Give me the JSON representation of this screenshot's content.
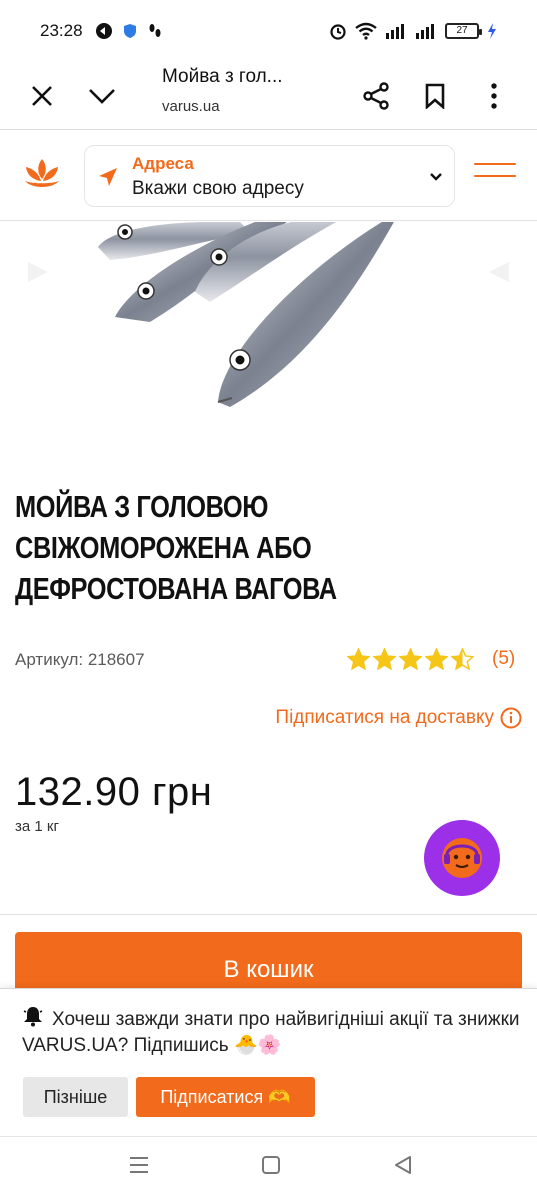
{
  "status_bar": {
    "time": "23:28",
    "battery_level": "27"
  },
  "browser": {
    "page_title": "Мойва з гол...",
    "url": "varus.ua"
  },
  "header": {
    "address_label": "Адреса",
    "address_placeholder": "Вкажи свою адресу"
  },
  "product": {
    "title_line1": "МОЙВА З ГОЛОВОЮ",
    "title_line2": "СВІЖОМОРОЖЕНА АБО",
    "title_line3": "ДЕФРОСТОВАНА ВАГОВА",
    "sku": "Артикул: 218607",
    "rating_value": 4.5,
    "rating_count": "(5)",
    "subscribe_delivery": "Підписатися на доставку",
    "price": "132.90 грн",
    "unit": "за 1 кг",
    "add_to_cart": "В кошик"
  },
  "notification": {
    "text": "Хочеш завжди знати про найвигідніші акції та знижки VARUS.UA? Підпишись 🐣🌸",
    "later_label": "Пізніше",
    "subscribe_label": "Підписатися 🫶"
  },
  "colors": {
    "accent": "#f26a1b",
    "assistant": "#9b30e8",
    "star": "#f5c518"
  },
  "icons": {
    "close": "close-icon",
    "chevron": "chevron-down-icon",
    "share": "share-icon",
    "bookmark": "bookmark-icon",
    "more": "more-vert-icon",
    "location": "navigation-arrow-icon",
    "info": "info-icon",
    "bell": "bell-icon"
  }
}
